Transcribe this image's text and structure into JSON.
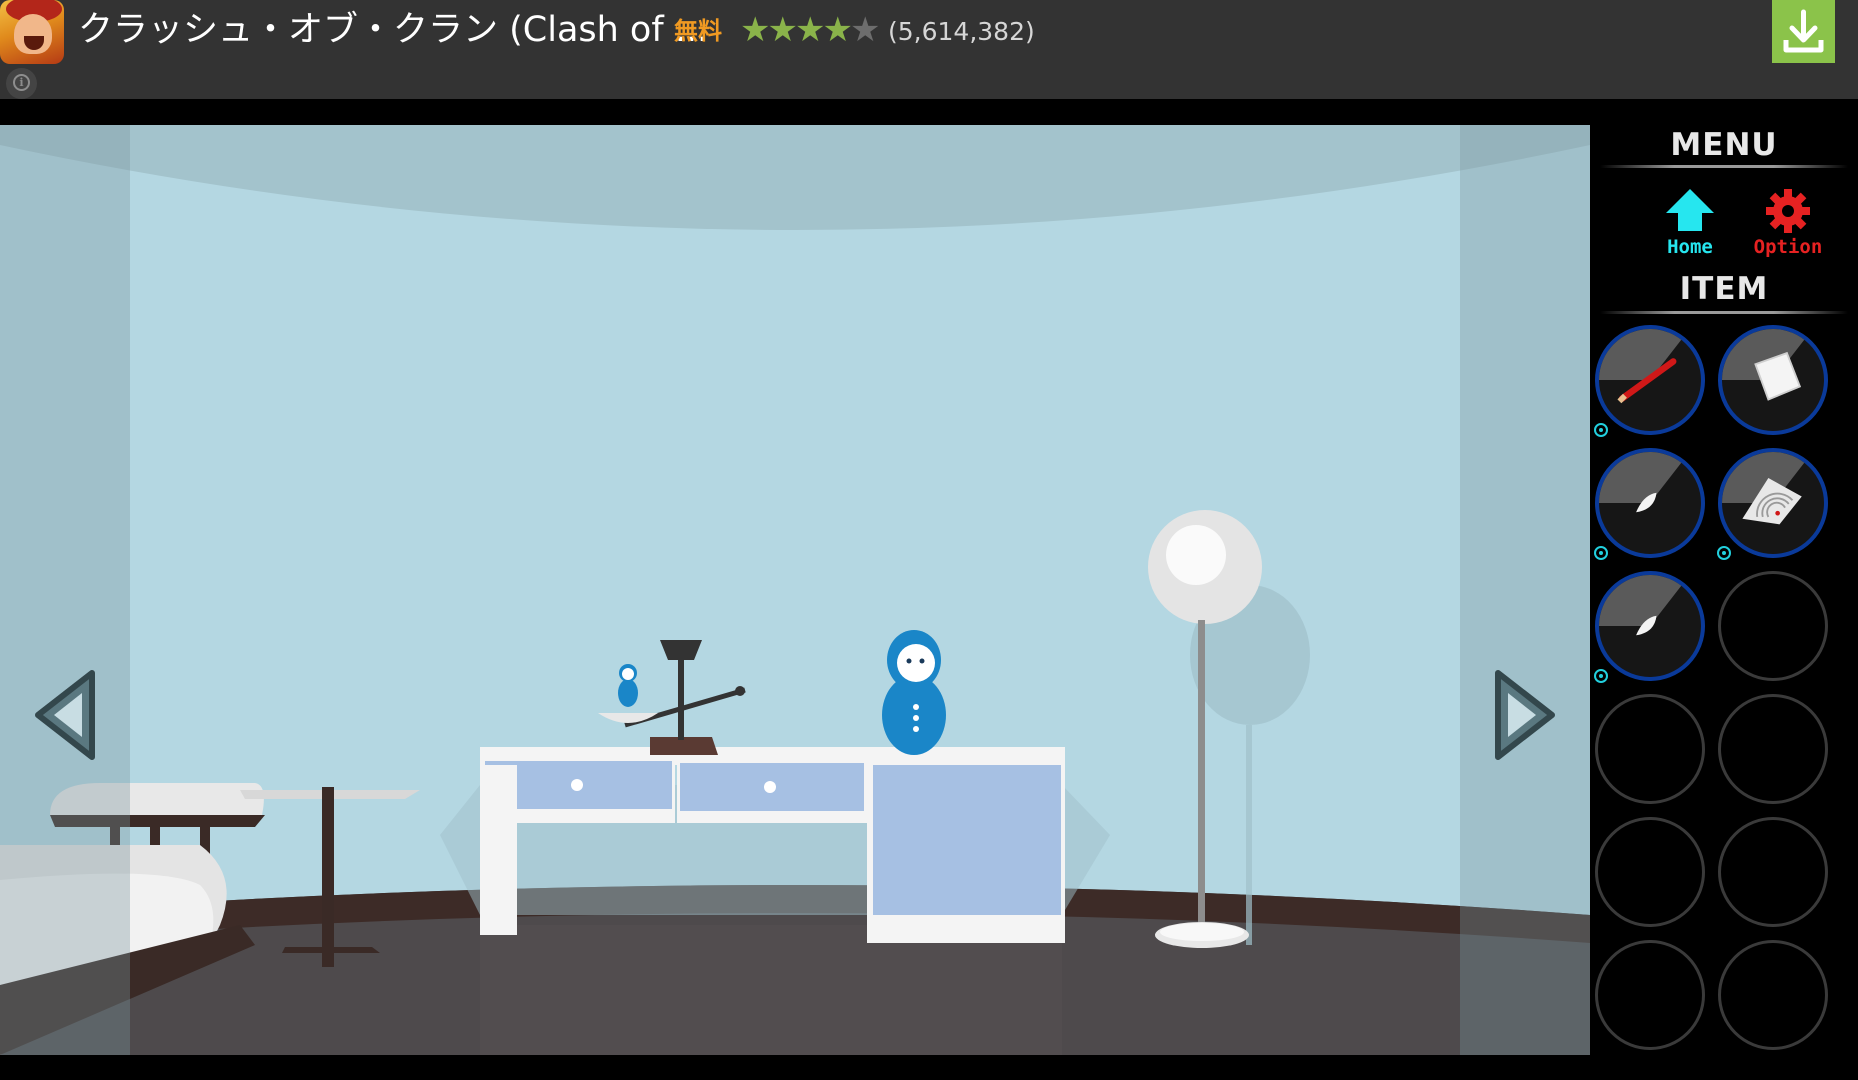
{
  "ad_banner": {
    "title": "クラッシュ・オブ・クラン (Clash of ...",
    "price_label": "無料",
    "rating_stars": 4.5,
    "rating_count": "(5,614,382)",
    "info_icon": "info-icon",
    "download_icon": "download-icon",
    "colors": {
      "background": "#333333",
      "price": "#f09a22",
      "stars": "#8ab34a",
      "download_button": "#8bc34a"
    }
  },
  "scene": {
    "nav": {
      "left_icon": "triangle-left-icon",
      "right_icon": "triangle-right-icon"
    },
    "objects": [
      "sofa",
      "side-table",
      "weighing-scale",
      "small-matryoshka-doll",
      "matryoshka-doll",
      "desk",
      "floor-lamp"
    ],
    "colors": {
      "wall": "#b4d7e2",
      "floor": "#4e4a4c",
      "desk_drawer": "#a6c0e3"
    }
  },
  "menu": {
    "header": "MENU",
    "home_label": "Home",
    "option_label": "Option",
    "item_header": "ITEM",
    "colors": {
      "home": "#26e6ef",
      "option": "#e62222",
      "slot_selected_border": "#0a3a9a"
    },
    "items": [
      {
        "item": "red-pencil",
        "filled": true,
        "has_indicator": true
      },
      {
        "item": "paper-note",
        "filled": true,
        "has_indicator": false
      },
      {
        "item": "white-seed",
        "filled": true,
        "has_indicator": true
      },
      {
        "item": "torn-paper-fragment",
        "filled": true,
        "has_indicator": true
      },
      {
        "item": "white-seed",
        "filled": true,
        "has_indicator": true
      },
      {
        "item": "",
        "filled": false,
        "has_indicator": false
      },
      {
        "item": "",
        "filled": false,
        "has_indicator": false
      },
      {
        "item": "",
        "filled": false,
        "has_indicator": false
      },
      {
        "item": "",
        "filled": false,
        "has_indicator": false
      },
      {
        "item": "",
        "filled": false,
        "has_indicator": false
      },
      {
        "item": "",
        "filled": false,
        "has_indicator": false
      },
      {
        "item": "",
        "filled": false,
        "has_indicator": false
      }
    ]
  }
}
